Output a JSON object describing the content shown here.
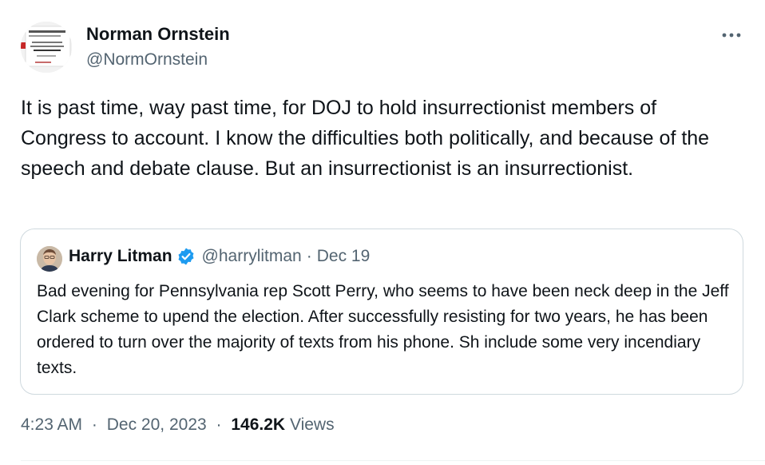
{
  "author": {
    "display_name": "Norman Ornstein",
    "handle": "@NormOrnstein",
    "avatar_icon": "profile-photo-quote-card"
  },
  "tweet": {
    "text": "It is past time, way past time, for DOJ to hold insurrectionist members of Congress to account. I know the difficulties both politically, and because of the speech and debate clause. But an insurrectionist is an insurrectionist."
  },
  "more_button": {
    "icon": "more-horizontal-icon",
    "glyph": "···"
  },
  "quote": {
    "display_name": "Harry Litman",
    "verified_icon": "verified-badge-icon",
    "handle": "@harrylitman",
    "separator": "·",
    "date": "Dec 19",
    "text": "Bad evening for Pennsylvania rep Scott Perry, who seems to have been neck deep in the Jeff Clark scheme to upend the election. After successfully resisting for two years, he has been ordered to turn over the majority of texts from his phone. Sh include some very incendiary texts."
  },
  "meta": {
    "time": "4:23 AM",
    "separator": "·",
    "date": "Dec 20, 2023",
    "views_count": "146.2K",
    "views_label": "Views"
  },
  "colors": {
    "text_primary": "#0f1419",
    "text_secondary": "#536471",
    "border": "#cfd9de",
    "verified_blue": "#1d9bf0"
  }
}
